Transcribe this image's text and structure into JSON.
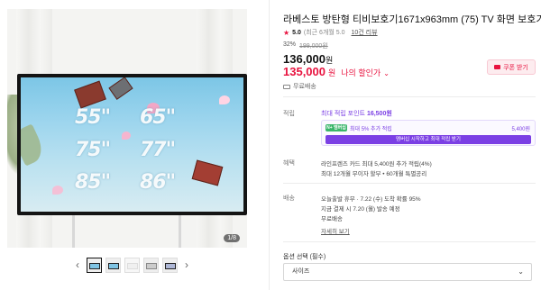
{
  "product": {
    "title": "라베스토 방탄형 티비보호기1671x963mm (75) TV 화면 보호기",
    "image_counter": "1/8",
    "screen_sizes": [
      "55\"",
      "65\"",
      "75\"",
      "77\"",
      "85\"",
      "86\""
    ]
  },
  "rating": {
    "star_icon": "★",
    "value": "5.0",
    "recent": "(최근 6개월 5.0",
    "review_link": "10건 리뷰"
  },
  "price": {
    "discount_pct": "32%",
    "original": "199,000원",
    "current": "136,000",
    "current_unit": "원",
    "sale": "135,000",
    "sale_unit": "원",
    "sale_label": "나의 할인가",
    "sale_chevron": "⌄",
    "coupon_button": "쿠폰 받기"
  },
  "shipping_summary": "무료배송",
  "points": {
    "label": "적립",
    "max_text": "최대 적립 포인트",
    "max_value": "16,500원",
    "badge": "N+ 멤버십",
    "extra_text": "최대 5% 추가 적립",
    "extra_amount": "5,400원",
    "cta": "멤버십 시작하고 최대 적립 받기"
  },
  "benefits": {
    "label": "혜택",
    "line1": "라인프렌즈 카드 최대 5,400원 추가 적립(4%)",
    "line2": "최대 12개월 무이자 할부 • 60개월 특별공리"
  },
  "delivery": {
    "label": "배송",
    "line1": "오늘출발 휴무 · 7.22 (수) 도착 확률 95%",
    "line2": "지금 결제 시 7.20 (월) 발송 예정",
    "line3": "무료배송",
    "more_link": "자세히 보기"
  },
  "options": {
    "label": "옵션 선택 (필수)",
    "select_value": "사이즈",
    "caret": "⌄"
  },
  "gallery": {
    "prev_arrow": "‹",
    "next_arrow": "›"
  },
  "colors": {
    "accent_red": "#e8133f",
    "purple": "#7b3fe4",
    "membership_green": "#3ab56a"
  }
}
